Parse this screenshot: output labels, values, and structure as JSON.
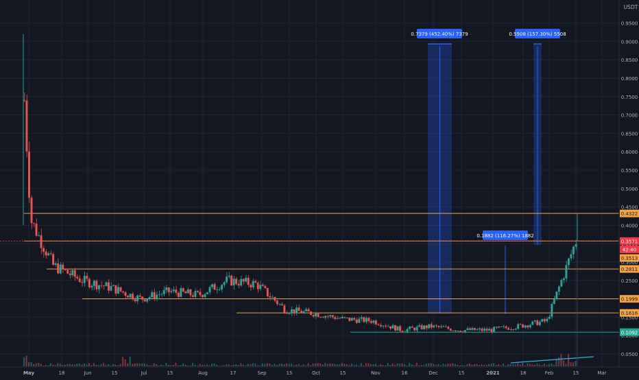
{
  "toolbar": {
    "currency_label": "USDT"
  },
  "y_axis": {
    "ticks": [
      "0.9500",
      "0.9000",
      "0.8500",
      "0.8000",
      "0.7500",
      "0.7000",
      "0.6500",
      "0.6000",
      "0.5500",
      "0.5000",
      "0.4500",
      "0.4000",
      "0.3500",
      "0.3000",
      "0.2500",
      "0.2000",
      "0.1500",
      "0.1000",
      "0.0500"
    ],
    "badges": [
      {
        "name": "price-badge-level-4322",
        "text": "0.4322",
        "value": 0.4322,
        "bg": "#f7a440",
        "fg": "#131722"
      },
      {
        "name": "price-badge-last",
        "text": "0.3571",
        "value": 0.3571,
        "bg": "#f23645",
        "fg": "#ffffff"
      },
      {
        "name": "price-badge-countdown",
        "text": "42:40",
        "value": 0.3345,
        "bg": "#f23645",
        "fg": "#ffffff"
      },
      {
        "name": "price-badge-level-3513",
        "text": "0.3513",
        "value": 0.311,
        "bg": "#f7a440",
        "fg": "#131722"
      },
      {
        "name": "price-badge-level-2811",
        "text": "0.2811",
        "value": 0.2811,
        "bg": "#f7a440",
        "fg": "#131722"
      },
      {
        "name": "price-badge-level-1999",
        "text": "0.1999",
        "value": 0.1999,
        "bg": "#f7a440",
        "fg": "#131722"
      },
      {
        "name": "price-badge-level-1616",
        "text": "0.1616",
        "value": 0.1616,
        "bg": "#f7a440",
        "fg": "#131722"
      },
      {
        "name": "price-badge-level-1092",
        "text": "0.1092",
        "value": 0.1092,
        "bg": "#22ab94",
        "fg": "#ffffff"
      }
    ]
  },
  "x_axis": {
    "ticks": [
      {
        "label": "May",
        "bold": true
      },
      {
        "label": "18",
        "bold": false
      },
      {
        "label": "Jun",
        "bold": false
      },
      {
        "label": "15",
        "bold": false
      },
      {
        "label": "Jul",
        "bold": false
      },
      {
        "label": "15",
        "bold": false
      },
      {
        "label": "Aug",
        "bold": false
      },
      {
        "label": "17",
        "bold": false
      },
      {
        "label": "Sep",
        "bold": false
      },
      {
        "label": "15",
        "bold": false
      },
      {
        "label": "Oct",
        "bold": false
      },
      {
        "label": "15",
        "bold": false
      },
      {
        "label": "Nov",
        "bold": false
      },
      {
        "label": "16",
        "bold": false
      },
      {
        "label": "Dec",
        "bold": false
      },
      {
        "label": "15",
        "bold": false
      },
      {
        "label": "2021",
        "bold": true
      },
      {
        "label": "18",
        "bold": false
      },
      {
        "label": "Feb",
        "bold": false
      },
      {
        "label": "15",
        "bold": false
      },
      {
        "label": "Mar",
        "bold": false
      }
    ]
  },
  "annotations": [
    {
      "name": "measure-label-dec",
      "text": "0.7379 (452.40%) 7379"
    },
    {
      "name": "measure-label-feb",
      "text": "0.5508 (157.30%) 5508"
    },
    {
      "name": "measure-label-jan",
      "text": "0.1882 (116.27%) 1882"
    }
  ],
  "horizontal_levels": [
    {
      "value": 0.4322,
      "color": "#f7a440"
    },
    {
      "value": 0.3571,
      "color": "#f7a440"
    },
    {
      "value": 0.2811,
      "color": "#f7a440"
    },
    {
      "value": 0.1999,
      "color": "#f7a440"
    },
    {
      "value": 0.1616,
      "color": "#f7a440"
    },
    {
      "value": 0.1092,
      "color": "#22ab94"
    }
  ],
  "colors": {
    "background": "#131722",
    "grid": "#1f2433",
    "up": "#26a69a",
    "down": "#ef5350",
    "measure": "#2962ff",
    "axis_text": "#b2b5be",
    "level": "#f7a440",
    "support": "#22ab94"
  },
  "chart_data": {
    "type": "line",
    "title": "",
    "ylabel": "USDT",
    "ylim": [
      0.03,
      0.98
    ],
    "grid": true,
    "legend": "none",
    "x": [
      "May",
      "18",
      "Jun",
      "15",
      "Jul",
      "15",
      "Aug",
      "17",
      "Sep",
      "15",
      "Oct",
      "15",
      "Nov",
      "16",
      "Dec",
      "15",
      "2021",
      "18",
      "Feb",
      "15"
    ],
    "series": [
      {
        "values": [
          0.45,
          0.29,
          0.25,
          0.23,
          0.2,
          0.22,
          0.21,
          0.25,
          0.24,
          0.17,
          0.16,
          0.145,
          0.14,
          0.115,
          0.125,
          0.115,
          0.115,
          0.125,
          0.14,
          0.357
        ]
      }
    ]
  }
}
